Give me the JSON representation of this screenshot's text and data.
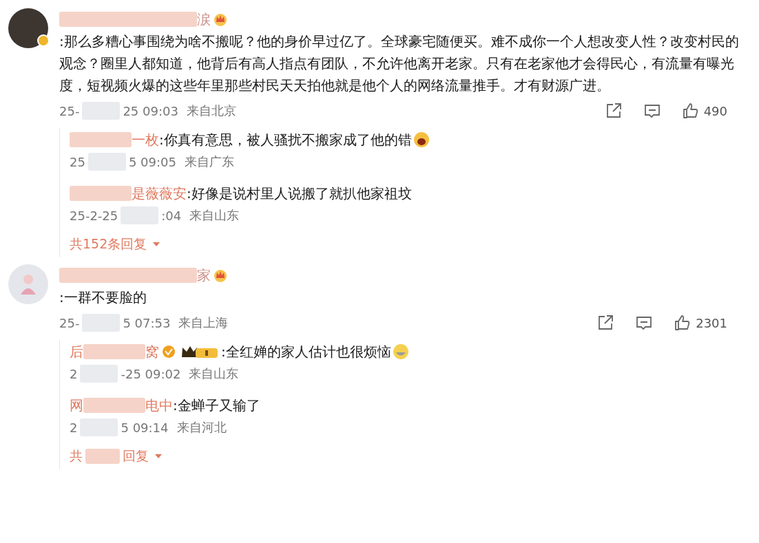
{
  "comments": [
    {
      "avatar": {
        "kind": "photo"
      },
      "name": {
        "end": "涙"
      },
      "badges": [
        {
          "kind": "crown"
        }
      ],
      "text": ":那么多糟心事围绕为啥不搬呢？他的身价早过亿了。全球豪宅随便买。难不成你一个人想改变人性？改变村民的观念？圈里人都知道，他背后有高人指点有团队，不允许他离开老家。只有在老家他才会得民心，有流量有曝光度，短视频火爆的这些年里那些村民天天拍他就是他个人的网络流量推手。才有财源广进。",
      "time": {
        "start": "25-",
        "end": "25 09:03"
      },
      "location": "来自北京",
      "likes": "490",
      "replies": [
        {
          "name": {
            "end": "一枚"
          },
          "text": ":你真有意思，被人骚扰不搬家成了他的错",
          "emoji": {
            "kind": "laugh"
          },
          "time": {
            "start": "25",
            "end": "5 09:05"
          },
          "location": "来自广东"
        },
        {
          "name": {
            "end": "是薇薇安"
          },
          "text": ":好像是说村里人说搬了就扒他家祖坟",
          "time": {
            "start": "25-2-25",
            "end": ":04"
          },
          "location": "来自山东"
        }
      ],
      "more": {
        "start": "共152条回复"
      }
    },
    {
      "avatar": {
        "kind": "cartoon"
      },
      "name": {
        "end": "家"
      },
      "badges": [
        {
          "kind": "crown"
        }
      ],
      "text": ":一群不要脸的",
      "time": {
        "start": "25-",
        "end": "5 07:53"
      },
      "location": "来自上海",
      "likes": "2301",
      "replies": [
        {
          "name": {
            "start": "后",
            "end": "窝"
          },
          "badges": [
            {
              "kind": "verified"
            },
            {
              "kind": "member"
            }
          ],
          "text": ":全红婵的家人估计也很烦恼",
          "emoji": {
            "kind": "grin"
          },
          "time": {
            "start": "2",
            "end": "-25 09:02"
          },
          "location": "来自山东"
        },
        {
          "name": {
            "start": "网",
            "end": "电中"
          },
          "text": ":金蝉子又输了",
          "time": {
            "start": "2",
            "end": "5 09:14"
          },
          "location": "来自河北"
        }
      ],
      "more": {
        "start": "共",
        "end": "回复"
      }
    }
  ]
}
